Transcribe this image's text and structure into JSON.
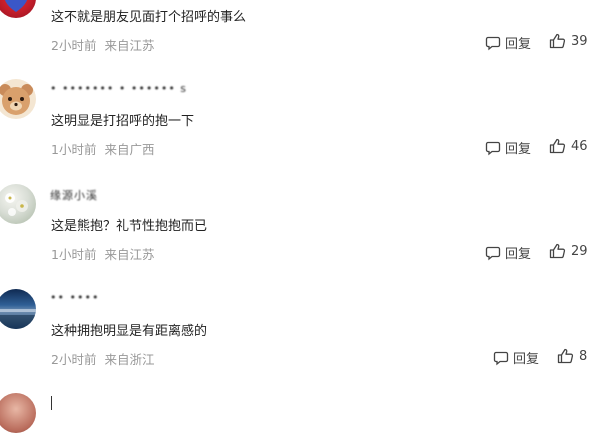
{
  "comments": [
    {
      "username": "",
      "text": "这不就是朋友见面打个招呼的事么",
      "time": "2小时前",
      "location": "来自江苏",
      "reply_label": "回复",
      "likes": "39"
    },
    {
      "username": "• ••••••• • •••••• s",
      "text": "这明显是打招呼的抱一下",
      "time": "1小时前",
      "location": "来自广西",
      "reply_label": "回复",
      "likes": "46"
    },
    {
      "username": "缘源小溪",
      "text": "这是熊抱？礼节性抱抱而已",
      "time": "1小时前",
      "location": "来自江苏",
      "reply_label": "回复",
      "likes": "29"
    },
    {
      "username": "•• ••••",
      "text": "这种拥抱明显是有距离感的",
      "time": "2小时前",
      "location": "来自浙江",
      "reply_label": "回复",
      "likes": "8"
    },
    {
      "username": "",
      "text": "",
      "time": "",
      "location": "",
      "reply_label": "",
      "likes": ""
    }
  ],
  "colors": {
    "text": "#222222",
    "meta": "#999999",
    "action": "#444444"
  }
}
